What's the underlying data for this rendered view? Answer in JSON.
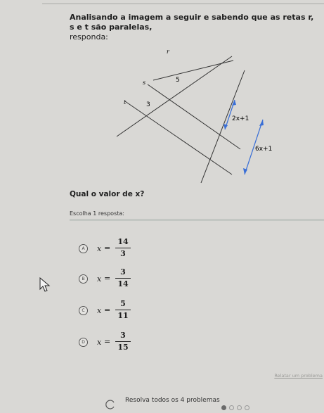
{
  "question": {
    "line1": "Analisando a imagem a seguir e sabendo que as retas r, s e t são paralelas,",
    "line2": "responda:"
  },
  "figure": {
    "line_labels": [
      "r",
      "s",
      "t"
    ],
    "segment_labels": [
      "5",
      "3",
      "2x+1",
      "6x+1"
    ],
    "arrow_color": "#3a6fd6"
  },
  "prompt": "Qual o valor de x?",
  "instruction": "Escolha 1 resposta:",
  "options": [
    {
      "letter": "A",
      "var": "x",
      "eq": "=",
      "num": "14",
      "den": "3"
    },
    {
      "letter": "B",
      "var": "x",
      "eq": "=",
      "num": "3",
      "den": "14"
    },
    {
      "letter": "C",
      "var": "x",
      "eq": "=",
      "num": "5",
      "den": "11"
    },
    {
      "letter": "D",
      "var": "x",
      "eq": "=",
      "num": "3",
      "den": "15"
    }
  ],
  "report_link": "Relatar um problema",
  "footer": {
    "text": "Resolva todos os 4 problemas",
    "progress_total": 4,
    "progress_current": 1,
    "icon": "checkmark-circle-icon"
  }
}
